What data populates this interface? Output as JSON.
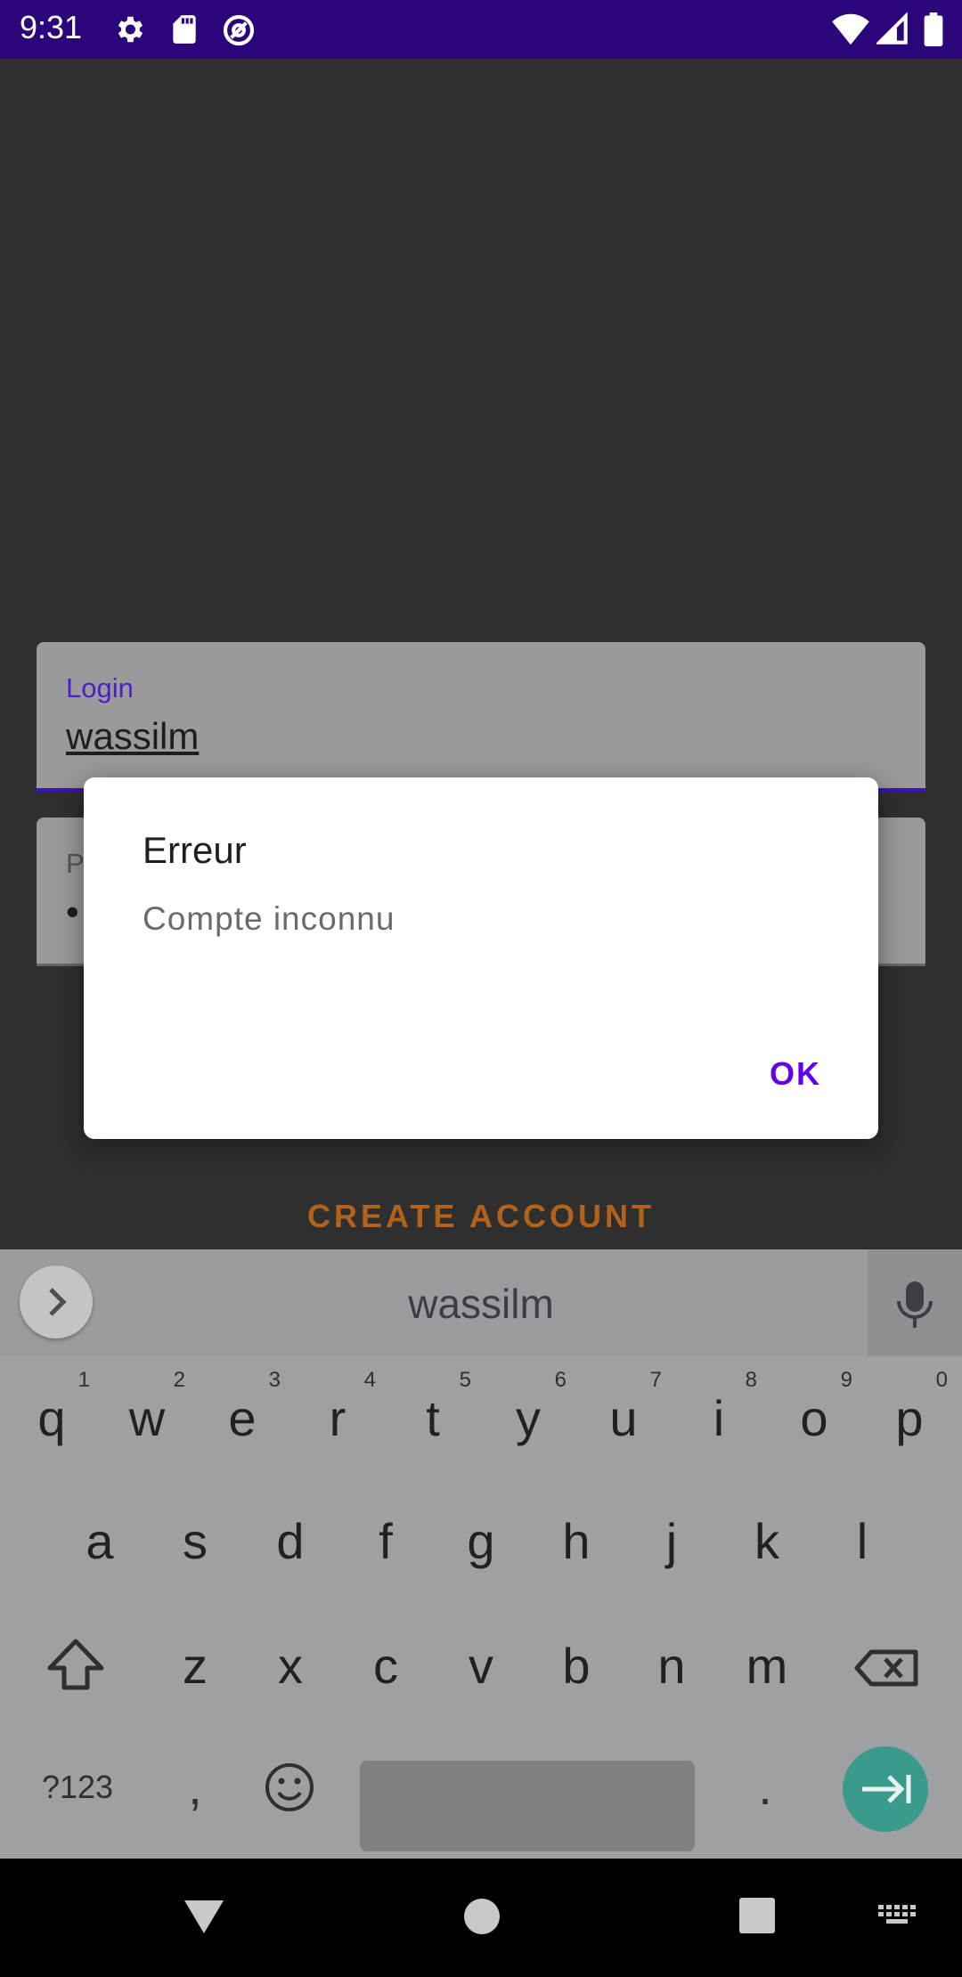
{
  "status_bar": {
    "time": "9:31",
    "left_icons": [
      "gear-icon",
      "sd-card-icon",
      "at-sign-icon"
    ],
    "right_icons": [
      "wifi-icon",
      "cell-signal-icon",
      "battery-icon"
    ]
  },
  "form": {
    "login_label": "Login",
    "login_value": "wassilm",
    "password_label": "P",
    "password_value": "••",
    "create_account": "CREATE ACCOUNT"
  },
  "dialog": {
    "title": "Erreur",
    "message": "Compte inconnu",
    "ok": "OK"
  },
  "keyboard": {
    "suggestion": "wassilm",
    "row1": [
      {
        "key": "q",
        "hint": "1"
      },
      {
        "key": "w",
        "hint": "2"
      },
      {
        "key": "e",
        "hint": "3"
      },
      {
        "key": "r",
        "hint": "4"
      },
      {
        "key": "t",
        "hint": "5"
      },
      {
        "key": "y",
        "hint": "6"
      },
      {
        "key": "u",
        "hint": "7"
      },
      {
        "key": "i",
        "hint": "8"
      },
      {
        "key": "o",
        "hint": "9"
      },
      {
        "key": "p",
        "hint": "0"
      }
    ],
    "row2": [
      "a",
      "s",
      "d",
      "f",
      "g",
      "h",
      "j",
      "k",
      "l"
    ],
    "row3": [
      "z",
      "x",
      "c",
      "v",
      "b",
      "n",
      "m"
    ],
    "symbols_key": "?123",
    "comma_key": ",",
    "period_key": "."
  },
  "colors": {
    "status_bar": "#2a067a",
    "accent": "#6200ee",
    "create_account": "#b3621b",
    "enter_key": "#3a9a8c"
  }
}
